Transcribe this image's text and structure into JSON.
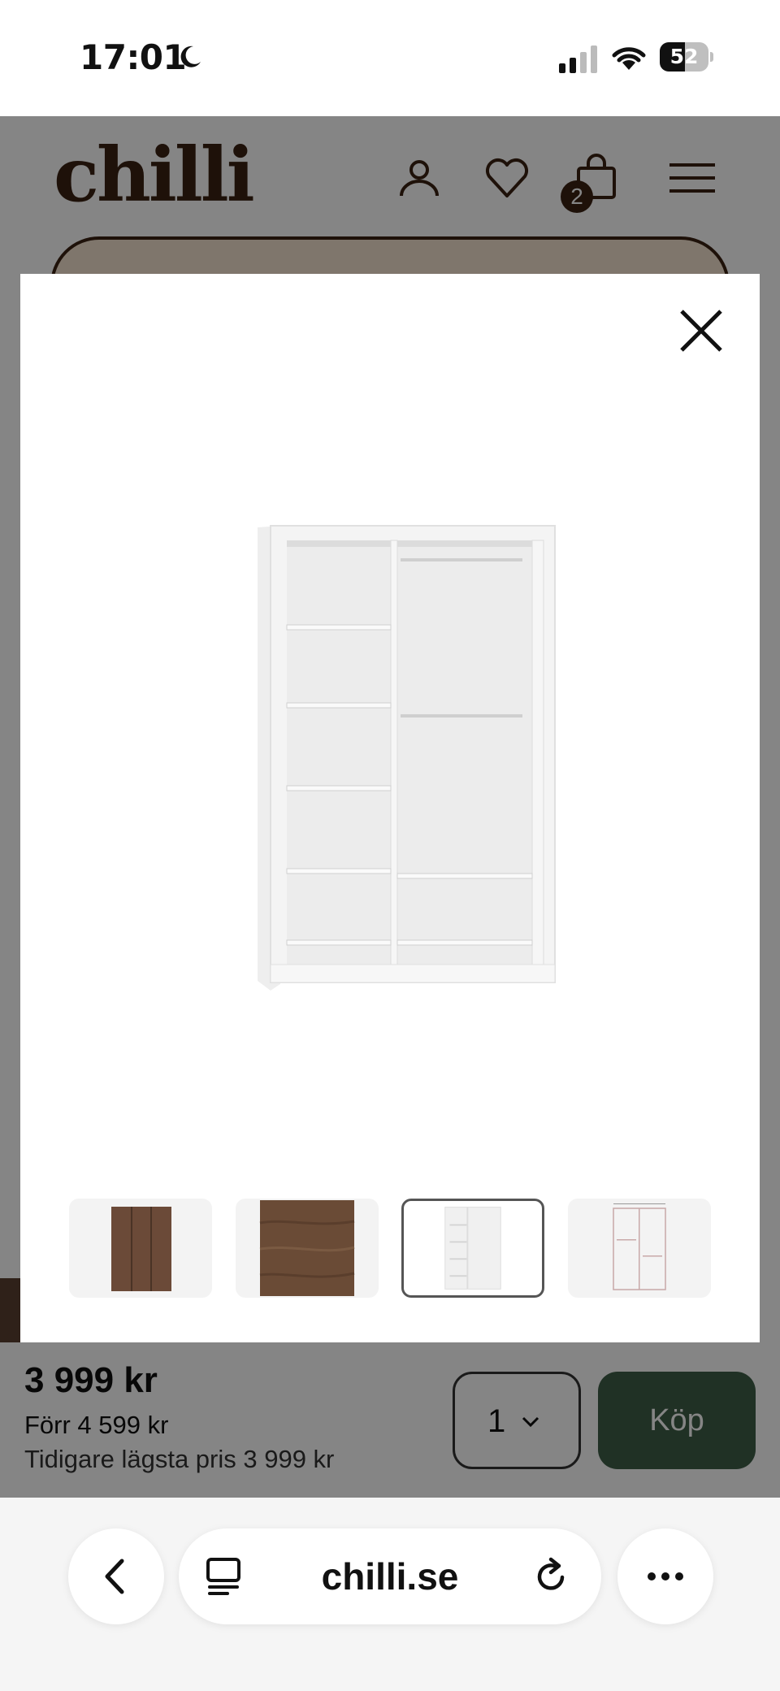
{
  "status_bar": {
    "time": "17:01",
    "battery": "52",
    "battery_level": 0.52
  },
  "site": {
    "logo": "chilli",
    "cart_count": "2"
  },
  "buy_bar": {
    "price": "3 999 kr",
    "old_price": "Förr 4 599 kr",
    "lowest_price": "Tidigare lägsta pris 3 999 kr",
    "quantity": "1",
    "buy_label": "Köp"
  },
  "modal": {
    "thumbnails": [
      {
        "name": "thumb-dark-wardrobe",
        "active": false
      },
      {
        "name": "thumb-wood-texture",
        "active": false
      },
      {
        "name": "thumb-white-wardrobe",
        "active": true
      },
      {
        "name": "thumb-dimension-drawing",
        "active": false
      }
    ]
  },
  "browser": {
    "url": "chilli.se"
  },
  "colors": {
    "brand": "#3b2212",
    "buy_button": "#3e5e48",
    "overlay": "rgba(0,0,0,0.48)"
  }
}
